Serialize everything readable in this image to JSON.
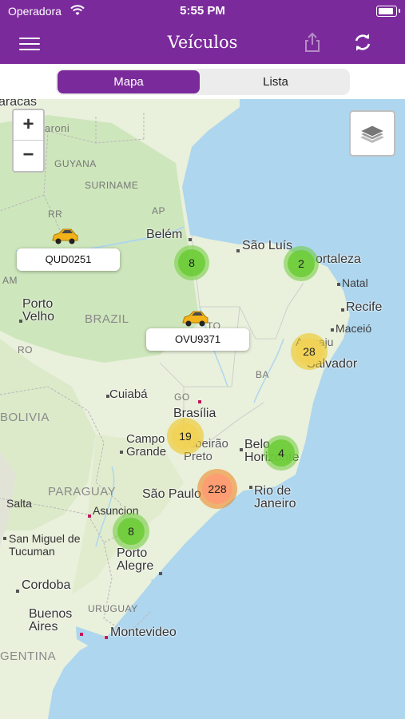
{
  "status_bar": {
    "carrier": "Operadora",
    "time": "5:55 PM"
  },
  "navbar": {
    "title": "Veículos",
    "menu_icon": "hamburger-menu-icon",
    "share_icon": "share-icon",
    "refresh_icon": "refresh-icon"
  },
  "segmented": {
    "options": [
      "Mapa",
      "Lista"
    ],
    "selected": "Mapa"
  },
  "map": {
    "zoom_in": "+",
    "zoom_out": "−",
    "layers_icon": "layers-icon",
    "labels": {
      "caracas": "aracas",
      "caroni": "Caroni",
      "guyana": "GUYANA",
      "suriname": "SURINAME",
      "rr": "RR",
      "ap": "AP",
      "am": "AM",
      "belem": "Belém",
      "sao_luis": "São Luís",
      "fortaleza": "ortaleza",
      "natal": "Natal",
      "recife": "Recife",
      "maceio": "Maceió",
      "aracaju": "Aracaju",
      "salvador": "Salvador",
      "porto_velho": "Porto\nVelho",
      "brazil": "BRAZIL",
      "ro": "RO",
      "to": "TO",
      "ba": "BA",
      "go": "GO",
      "cuiaba": "Cuiabá",
      "brasilia": "Brasília",
      "bolivia": "BOLIVIA",
      "campo_grande": "Campo\nGrande",
      "ribeirao_preto": "Ribeirão\nPreto",
      "belo_horizonte": "Belo\nHorizonte",
      "sao_paulo": "São Paulo",
      "rio": "Rio de\nJaneiro",
      "paraguay": "PARAGUAY",
      "salta": "Salta",
      "asuncion": "Asuncion",
      "tucuman": "San Miguel de\nTucuman",
      "porto_alegre": "Porto\nAlegre",
      "cordoba": "Cordoba",
      "uruguay": "URUGUAY",
      "buenos_aires": "Buenos\nAires",
      "montevideo": "Montevideo",
      "argentina": "GENTINA"
    },
    "clusters": [
      {
        "count": "8",
        "color": "#6ecc39"
      },
      {
        "count": "2",
        "color": "#6ecc39"
      },
      {
        "count": "28",
        "color": "#f0c20c"
      },
      {
        "count": "19",
        "color": "#f0c20c"
      },
      {
        "count": "4",
        "color": "#6ecc39"
      },
      {
        "count": "228",
        "color": "#f18017"
      },
      {
        "count": "8",
        "color": "#6ecc39"
      }
    ],
    "vehicles": [
      {
        "plate": "QUD0251",
        "icon": "yellow-car-icon"
      },
      {
        "plate": "OVU9371",
        "icon": "yellow-car-icon"
      }
    ]
  },
  "colors": {
    "brand": "#7b2a9b",
    "sea": "#aed6ee",
    "land": "#e9f0dc",
    "forest": "#c7e3b4"
  }
}
